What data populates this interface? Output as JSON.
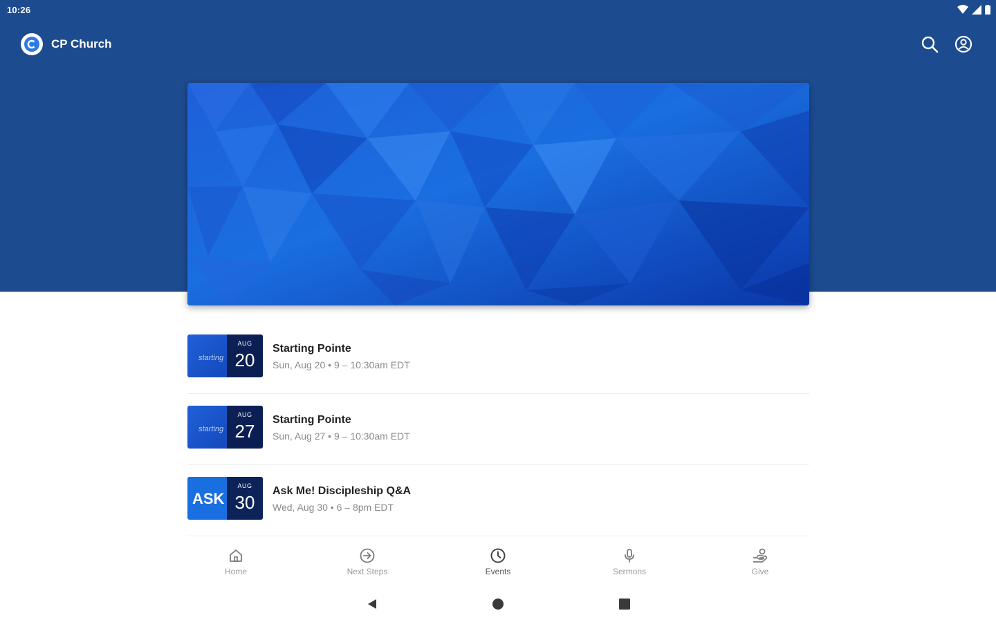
{
  "status_bar": {
    "time": "10:26"
  },
  "app_bar": {
    "title": "CP Church",
    "logo_letter": "C"
  },
  "colors": {
    "brand": "#1d4b8f",
    "hero_blue": "#1050c8",
    "nav_text": "#9a9a9a"
  },
  "events": [
    {
      "title": "Starting Pointe",
      "subtitle": "Sun, Aug 20 • 9 – 10:30am EDT",
      "month": "AUG",
      "day": "20",
      "thumb_word": "starting",
      "thumb_style": "blue"
    },
    {
      "title": "Starting Pointe",
      "subtitle": "Sun, Aug 27 • 9 – 10:30am EDT",
      "month": "AUG",
      "day": "27",
      "thumb_word": "starting",
      "thumb_style": "blue"
    },
    {
      "title": "Ask Me! Discipleship Q&A",
      "subtitle": "Wed, Aug 30 • 6 – 8pm EDT",
      "month": "AUG",
      "day": "30",
      "thumb_word": "ASK",
      "thumb_style": "ask"
    }
  ],
  "bottom_nav": [
    {
      "label": "Home",
      "icon": "home-icon"
    },
    {
      "label": "Next Steps",
      "icon": "arrow-circle-icon"
    },
    {
      "label": "Events",
      "icon": "clock-icon"
    },
    {
      "label": "Sermons",
      "icon": "microphone-icon"
    },
    {
      "label": "Give",
      "icon": "give-hand-icon"
    }
  ],
  "icons": {
    "search": "search-icon",
    "account": "account-circle-icon",
    "wifi": "wifi-icon",
    "signal": "signal-icon",
    "battery": "battery-icon",
    "back": "back-triangle-icon",
    "home": "home-circle-icon",
    "recents": "recents-square-icon"
  }
}
